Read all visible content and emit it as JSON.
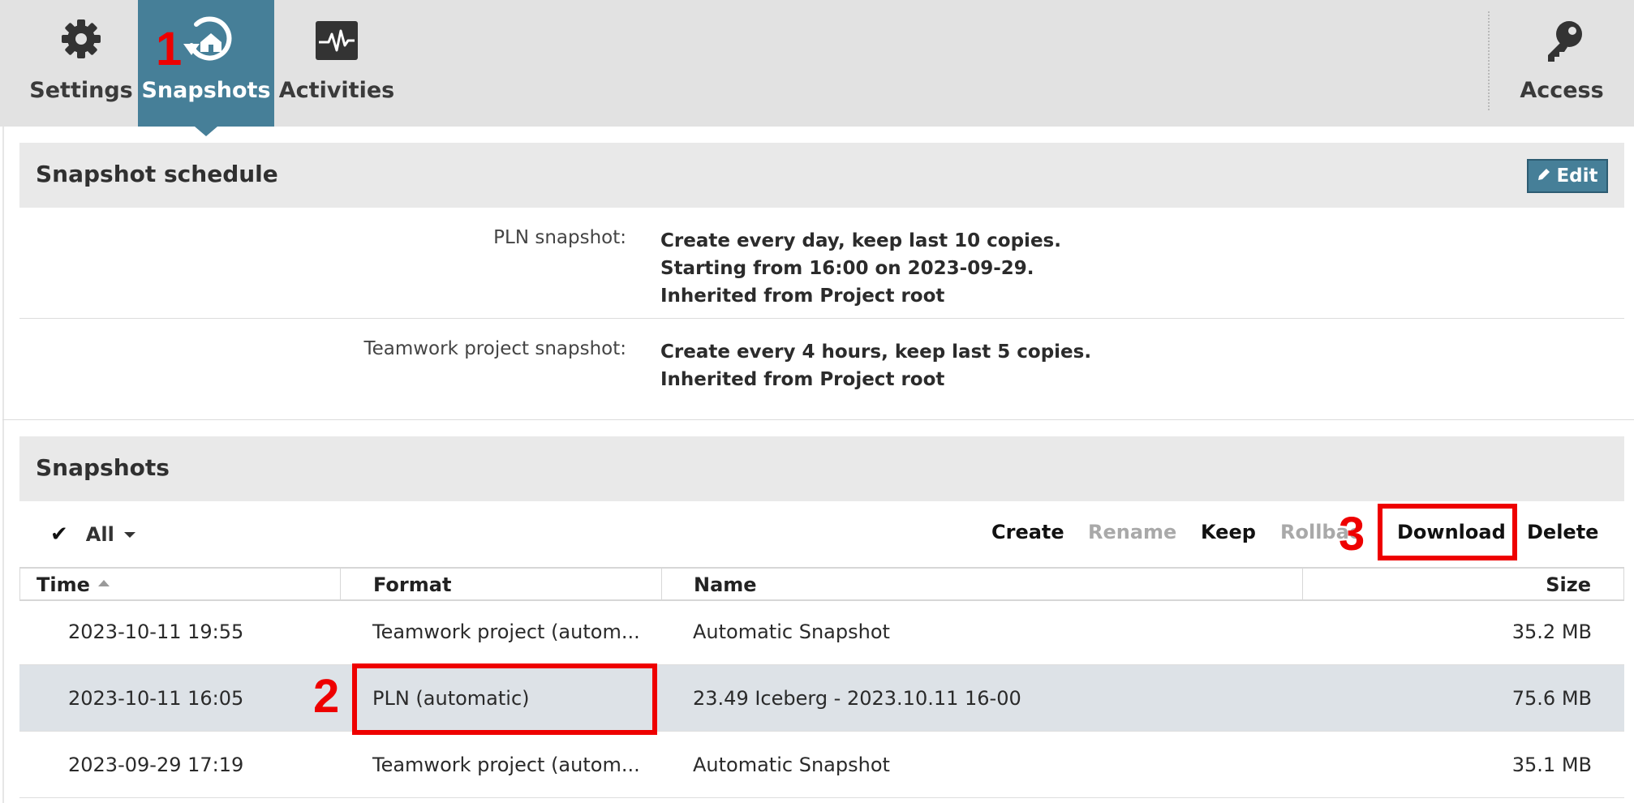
{
  "toolbar": {
    "tabs": [
      {
        "label": "Settings",
        "icon": "gear-icon"
      },
      {
        "label": "Snapshots",
        "icon": "snapshot-restore-icon"
      },
      {
        "label": "Activities",
        "icon": "activity-monitor-icon"
      }
    ],
    "access_label": "Access",
    "access_icon": "key-icon",
    "active_color": "#467f98"
  },
  "markers": {
    "one": "1",
    "two": "2",
    "three": "3",
    "color": "#ee0000"
  },
  "schedule": {
    "title": "Snapshot schedule",
    "edit_label": "Edit",
    "rows": [
      {
        "label": "PLN snapshot:",
        "lines": [
          "Create every day, keep last 10 copies.",
          "Starting from 16:00 on 2023-09-29.",
          "Inherited from Project root"
        ]
      },
      {
        "label": "Teamwork project snapshot:",
        "lines": [
          "Create every 4 hours, keep last 5 copies.",
          "Inherited from Project root"
        ]
      }
    ]
  },
  "snapshots": {
    "title": "Snapshots",
    "select_all_label": "All",
    "actions": {
      "create": "Create",
      "rename": "Rename",
      "keep": "Keep",
      "rollback": "Rollbac",
      "download": "Download",
      "delete": "Delete"
    },
    "columns": {
      "time": "Time",
      "format": "Format",
      "name": "Name",
      "size": "Size"
    },
    "rows": [
      {
        "time": "2023-10-11 19:55",
        "format": "Teamwork project (autom...",
        "name": "Automatic Snapshot",
        "size": "35.2 MB"
      },
      {
        "time": "2023-10-11 16:05",
        "format": "PLN (automatic)",
        "name": "23.49 Iceberg - 2023.10.11 16-00",
        "size": "75.6 MB"
      },
      {
        "time": "2023-09-29 17:19",
        "format": "Teamwork project (autom...",
        "name": "Automatic Snapshot",
        "size": "35.1 MB"
      }
    ]
  }
}
